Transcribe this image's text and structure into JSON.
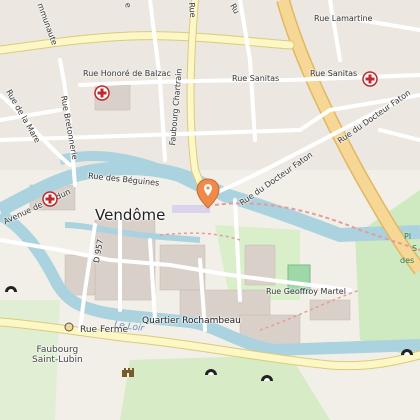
{
  "map": {
    "labels": {
      "city": "Vendôme",
      "quartier": "Quartier Rochambeau",
      "faubourg_line1": "Faubourg",
      "faubourg_line2": "Saint-Lubin",
      "river": "Le Loir",
      "park_partial_1": "Pl",
      "park_partial_2": "S",
      "park_partial_3": "des"
    },
    "streets": {
      "rue_lamartine": "Rue Lamartine",
      "rue_sanitas_1": "Rue Sanitas",
      "rue_sanitas_2": "Rue Sanitas",
      "rue_honore_de_balzac": "Rue Honoré de Balzac",
      "rue_des_beguines": "Rue des Béguines",
      "rue_de_la_mare": "Rue de la Mare",
      "rue_bretonnerie": "Rue Bretonnerie",
      "faubourg_chartrain": "Faubourg Chartrain",
      "rue_du_docteur_faton_1": "Rue du Docteur Faton",
      "rue_du_docteur_faton_2": "Rue du Docteur Faton",
      "avenue_de_verdun": "Avenue de Verdun",
      "d957": "D 957",
      "rue_geoffroy_martel": "Rue Geoffroy Martel",
      "rue_ferme": "Rue Ferme",
      "communaute": "mmunaute",
      "top_rue": "e",
      "top_rue_2": "Rue",
      "top_partial": "Ru"
    },
    "colors": {
      "background": "#f2efe9",
      "water": "#aad3df",
      "major_road": "#f7d796",
      "major_road_border": "#e0b860",
      "secondary_road": "#fcf7c5",
      "park": "#cfeac0",
      "railway": "#b0a8c8",
      "marker": "#f08a4b"
    },
    "icons": {
      "hospital_1": "hospital-icon",
      "hospital_2": "hospital-icon",
      "location_marker": "location-marker-icon",
      "castle": "castle-icon",
      "tunnel_1": "tunnel-icon",
      "tunnel_2": "tunnel-icon",
      "tunnel_3": "tunnel-icon",
      "tunnel_4": "tunnel-icon"
    }
  }
}
